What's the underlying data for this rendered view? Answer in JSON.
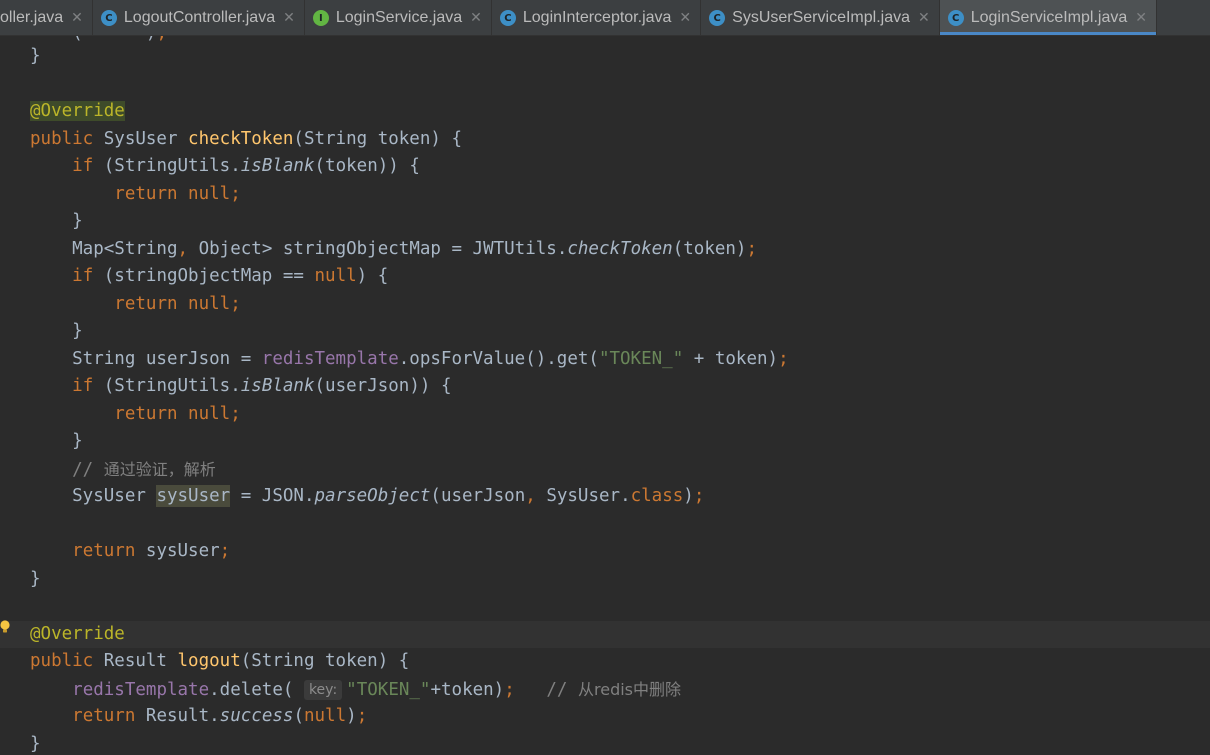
{
  "tabs": [
    {
      "label": "oller.java",
      "icon": "none",
      "active": false
    },
    {
      "label": "LogoutController.java",
      "icon": "class",
      "active": false
    },
    {
      "label": "LoginService.java",
      "icon": "interface",
      "active": false
    },
    {
      "label": "LoginInterceptor.java",
      "icon": "class",
      "active": false
    },
    {
      "label": "SysUserServiceImpl.java",
      "icon": "class",
      "active": false
    },
    {
      "label": "LoginServiceImpl.java",
      "icon": "class",
      "active": true
    }
  ],
  "icons": {
    "class_letter": "C",
    "interface_letter": "I",
    "close": "✕",
    "bulb": "lightbulb-icon"
  },
  "colors": {
    "keyword": "#cc7832",
    "annotation": "#bbb529",
    "method": "#ffc66d",
    "string": "#6a8759",
    "field": "#9876aa",
    "comment": "#808080",
    "text": "#a9b7c6",
    "accent": "#4a88c7"
  },
  "code": {
    "l0": {
      "a": "    ",
      "b": "(",
      "c": "      ",
      "d": ")",
      "e": ";"
    },
    "l1": {
      "a": "}"
    },
    "l3": {
      "a": "@Override"
    },
    "l4": {
      "a": "public",
      "b": " SysUser ",
      "c": "checkToken",
      "d": "(String token) {"
    },
    "l5": {
      "a": "    ",
      "b": "if",
      "c": " (StringUtils.",
      "d": "isBlank",
      "e": "(token)) {"
    },
    "l6": {
      "a": "        ",
      "b": "return null;"
    },
    "l7": {
      "a": "    }"
    },
    "l8": {
      "a": "    Map<String",
      "b": ",",
      "c": " Object> stringObjectMap = JWTUtils.",
      "d": "checkToken",
      "e": "(token)",
      "f": ";"
    },
    "l9": {
      "a": "    ",
      "b": "if",
      "c": " (stringObjectMap == ",
      "d": "null",
      "e": ") {"
    },
    "l10": {
      "a": "        ",
      "b": "return null;"
    },
    "l11": {
      "a": "    }"
    },
    "l12": {
      "a": "    String userJson = ",
      "b": "redisTemplate",
      "c": ".opsForValue().get(",
      "d": "\"TOKEN_\"",
      "e": " + token)",
      "f": ";"
    },
    "l13": {
      "a": "    ",
      "b": "if",
      "c": " (StringUtils.",
      "d": "isBlank",
      "e": "(userJson)) {"
    },
    "l14": {
      "a": "        ",
      "b": "return null;"
    },
    "l15": {
      "a": "    }"
    },
    "l16": {
      "a": "    // ",
      "b": "通过验证，解析"
    },
    "l17": {
      "a": "    SysUser ",
      "b": "sysUser",
      "c": " = JSON.",
      "d": "parseObject",
      "e": "(userJson",
      "f": ",",
      "g": " SysUser.",
      "h": "class",
      "i": ")",
      "j": ";"
    },
    "l19": {
      "a": "    ",
      "b": "return",
      "c": " sysUser",
      "d": ";"
    },
    "l20": {
      "a": "}"
    },
    "l22": {
      "a": "@Override"
    },
    "l23": {
      "a": "public",
      "b": " Result ",
      "c": "logout",
      "d": "(String token) {"
    },
    "l24": {
      "a": "    ",
      "b": "redisTemplate",
      "c": ".delete( ",
      "hint": "key:",
      "d": "\"TOKEN_\"",
      "e": "+token)",
      "f": ";",
      "g": "   // ",
      "h": "从redis中删除"
    },
    "l25": {
      "a": "    ",
      "b": "return",
      "c": " Result.",
      "d": "success",
      "e": "(",
      "f": "null",
      "g": ")",
      "h": ";"
    },
    "l26": {
      "a": "}"
    }
  }
}
